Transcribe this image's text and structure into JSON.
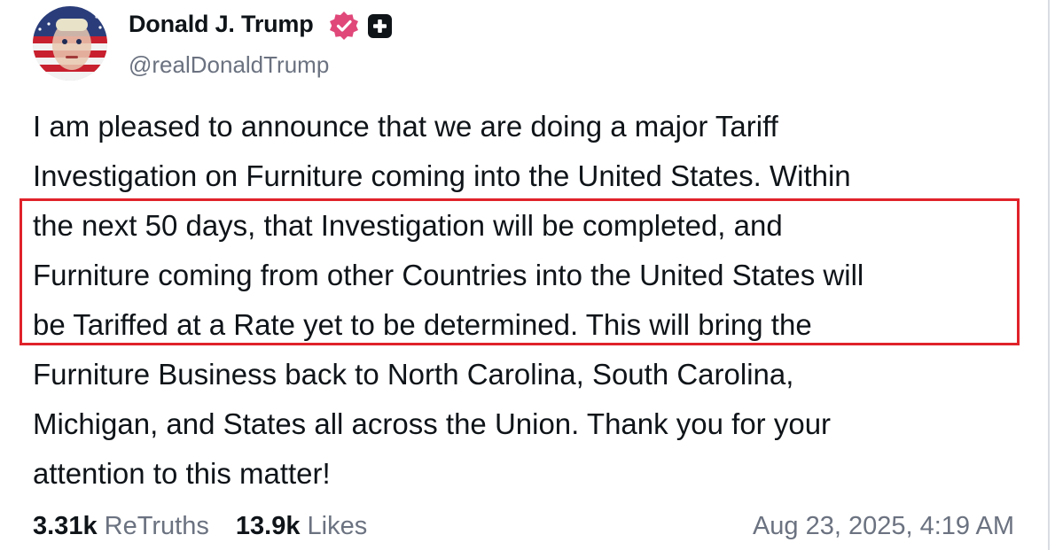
{
  "author": {
    "display_name": "Donald J. Trump",
    "handle": "@realDonaldTrump",
    "avatar_icon": "profile-photo-flag-face",
    "verified_icon": "verified-badge-icon",
    "verified_color": "#e0487a",
    "plus_icon": "plus-badge-icon"
  },
  "post": {
    "text": "I am pleased to announce that we are doing a major Tariff\nInvestigation on Furniture coming into the United States. Within\nthe next 50 days, that Investigation will be completed, and\nFurniture coming from other Countries into the United States will\nbe Tariffed at a Rate yet to be determined. This will bring the\nFurniture Business back to North Carolina, South Carolina,\nMichigan, and States all across the Union. Thank you for your\nattention to this matter!",
    "highlight_color": "#e0222a"
  },
  "stats": {
    "retruths_count": "3.31k",
    "retruths_label": "ReTruths",
    "likes_count": "13.9k",
    "likes_label": "Likes"
  },
  "timestamp": "Aug 23, 2025, 4:19 AM"
}
